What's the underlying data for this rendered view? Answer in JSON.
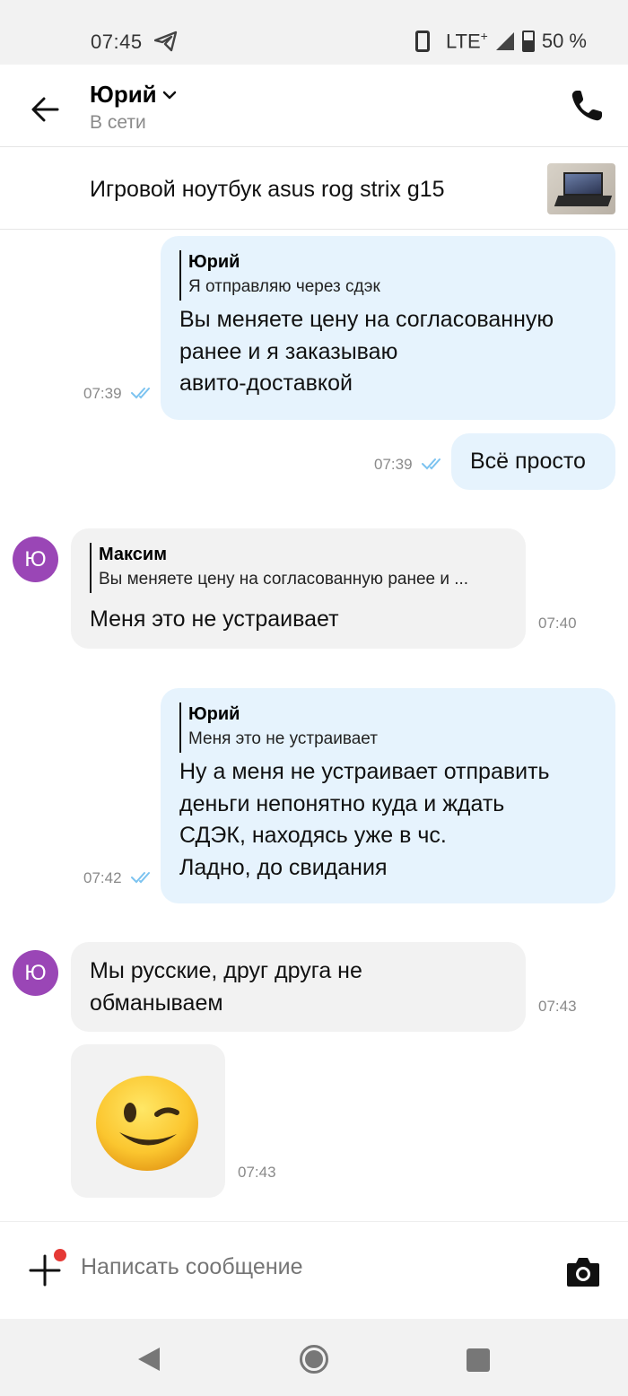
{
  "status_bar": {
    "time": "07:45",
    "network": "LTE",
    "network_sup": "+",
    "battery": "50 %",
    "icons": [
      "telegram-icon",
      "phone-vibrate-icon",
      "signal-icon",
      "battery-icon"
    ]
  },
  "header": {
    "contact_name": "Юрий",
    "contact_status": "В сети",
    "icons": [
      "back-arrow-icon",
      "chevron-down-icon",
      "phone-call-icon"
    ]
  },
  "item": {
    "title": "Игровой ноутбук asus rog strix g15"
  },
  "messages": [
    {
      "direction": "out",
      "quote_author": "Юрий",
      "quote_text": "Я отправляю через сдэк",
      "text": "Вы меняете цену на согласованную\nранее и я заказываю\nавито-доставкой",
      "time": "07:39",
      "read": true
    },
    {
      "direction": "out",
      "text": "Всё просто",
      "time": "07:39",
      "read": true
    },
    {
      "direction": "in",
      "avatar": "Ю",
      "quote_author": "Максим",
      "quote_text": "Вы меняете цену на согласованную ранее и ...",
      "text": "Меня это не устраивает",
      "time": "07:40"
    },
    {
      "direction": "out",
      "quote_author": "Юрий",
      "quote_text": "Меня это не устраивает",
      "text": "Ну а меня не устраивает отправить\nденьги непонятно куда и ждать\nСДЭК, находясь уже в чс.\nЛадно, до свидания",
      "time": "07:42",
      "read": true
    },
    {
      "direction": "in",
      "avatar": "Ю",
      "text": "Мы русские, друг друга не\nобманываем",
      "time": "07:43"
    },
    {
      "direction": "in",
      "type": "sticker",
      "sticker": "winking-face-emoji",
      "time": "07:43"
    }
  ],
  "composer": {
    "placeholder": "Написать сообщение",
    "icons": [
      "plus-icon",
      "camera-icon"
    ],
    "notification_color": "#e53935"
  },
  "colors": {
    "outgoing_bubble": "#e6f3fd",
    "incoming_bubble": "#f2f2f2",
    "avatar": "#9a46b6",
    "read_ticks": "#7cc3f0"
  }
}
